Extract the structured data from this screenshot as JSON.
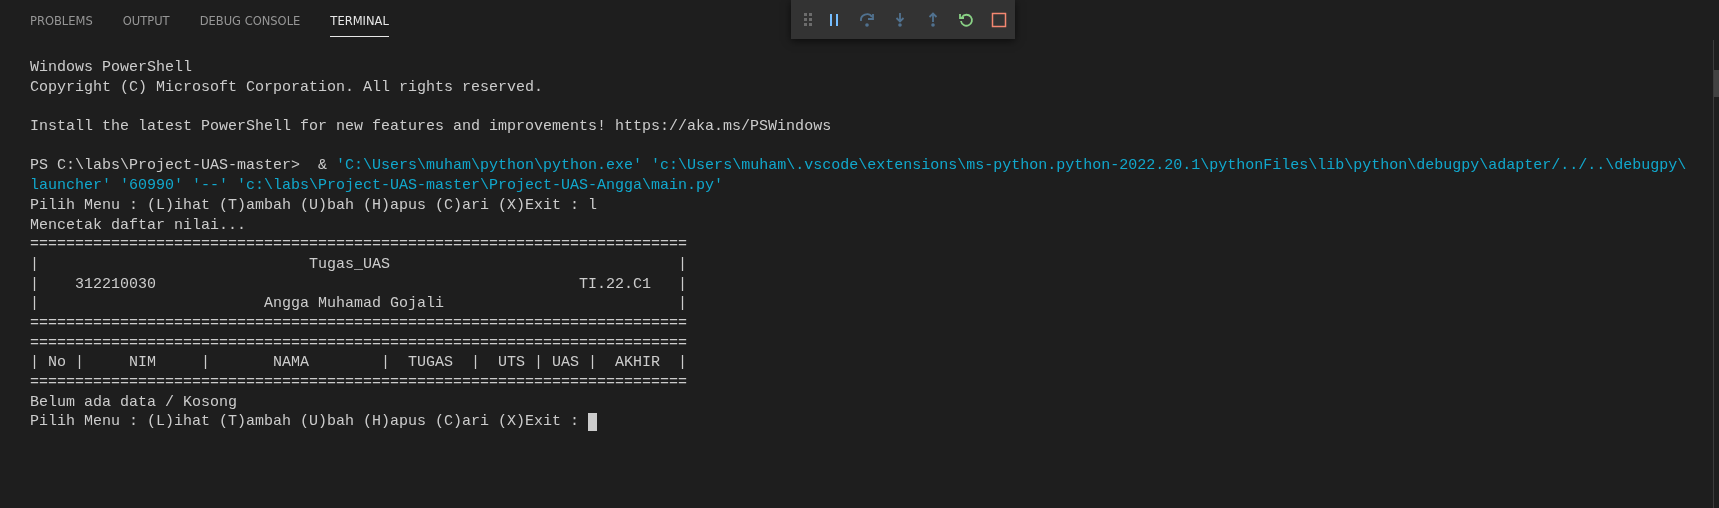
{
  "panel_tabs": [
    {
      "label": "PROBLEMS",
      "selected": false
    },
    {
      "label": "OUTPUT",
      "selected": false
    },
    {
      "label": "DEBUG CONSOLE",
      "selected": false
    },
    {
      "label": "TERMINAL",
      "selected": true
    }
  ],
  "debug_toolbar": [
    {
      "kind": "gripper",
      "disabled": false
    },
    {
      "kind": "pause",
      "disabled": false
    },
    {
      "kind": "step-over",
      "disabled": true
    },
    {
      "kind": "step-into",
      "disabled": true
    },
    {
      "kind": "step-out",
      "disabled": true
    },
    {
      "kind": "restart",
      "disabled": false
    },
    {
      "kind": "stop",
      "disabled": false
    }
  ],
  "terminal_lines": [
    {
      "kind": "text",
      "segments": [
        {
          "kind": "plain",
          "text": "Windows PowerShell"
        }
      ]
    },
    {
      "kind": "text",
      "segments": [
        {
          "kind": "plain",
          "text": "Copyright (C) Microsoft Corporation. All rights reserved."
        }
      ]
    },
    {
      "kind": "blank"
    },
    {
      "kind": "text",
      "segments": [
        {
          "kind": "plain",
          "text": "Install the latest PowerShell for new features and improvements! https://aka.ms/PSWindows"
        }
      ]
    },
    {
      "kind": "blank"
    },
    {
      "kind": "text",
      "segments": [
        {
          "kind": "plain",
          "text": "PS C:\\labs\\Project-UAS-master>  & "
        },
        {
          "kind": "string",
          "text": "'C:\\Users\\muham\\python\\python.exe' 'c:\\Users\\muham\\.vscode\\extensions\\ms-python.python-2022.20.1\\pythonFiles\\lib\\python\\debugpy\\adapter/../..\\debugpy\\"
        }
      ]
    },
    {
      "kind": "text",
      "segments": [
        {
          "kind": "string",
          "text": "launcher' '60990' '--' 'c:\\labs\\Project-UAS-master\\Project-UAS-Angga\\main.py'"
        }
      ]
    },
    {
      "kind": "text",
      "segments": [
        {
          "kind": "plain",
          "text": "Pilih Menu : (L)ihat (T)ambah (U)bah (H)apus (C)ari (X)Exit : l"
        }
      ]
    },
    {
      "kind": "text",
      "segments": [
        {
          "kind": "plain",
          "text": "Mencetak daftar nilai..."
        }
      ]
    },
    {
      "kind": "text",
      "segments": [
        {
          "kind": "plain",
          "text": "========================================================================="
        }
      ]
    },
    {
      "kind": "text",
      "segments": [
        {
          "kind": "plain",
          "text": "|                              Tugas_UAS                                |"
        }
      ]
    },
    {
      "kind": "text",
      "segments": [
        {
          "kind": "plain",
          "text": "|    312210030                                               TI.22.C1   |"
        }
      ]
    },
    {
      "kind": "text",
      "segments": [
        {
          "kind": "plain",
          "text": "|                         Angga Muhamad Gojali                          |"
        }
      ]
    },
    {
      "kind": "text",
      "segments": [
        {
          "kind": "plain",
          "text": "========================================================================="
        }
      ]
    },
    {
      "kind": "text",
      "segments": [
        {
          "kind": "plain",
          "text": "========================================================================="
        }
      ]
    },
    {
      "kind": "text",
      "segments": [
        {
          "kind": "plain",
          "text": "| No |     NIM     |       NAMA        |  TUGAS  |  UTS | UAS |  AKHIR  |"
        }
      ]
    },
    {
      "kind": "text",
      "segments": [
        {
          "kind": "plain",
          "text": "========================================================================="
        }
      ]
    },
    {
      "kind": "text",
      "segments": [
        {
          "kind": "plain",
          "text": "Belum ada data / Kosong"
        }
      ]
    },
    {
      "kind": "text",
      "cursor": true,
      "segments": [
        {
          "kind": "plain",
          "text": "Pilih Menu : (L)ihat (T)ambah (U)bah (H)apus (C)ari (X)Exit : "
        }
      ]
    }
  ]
}
